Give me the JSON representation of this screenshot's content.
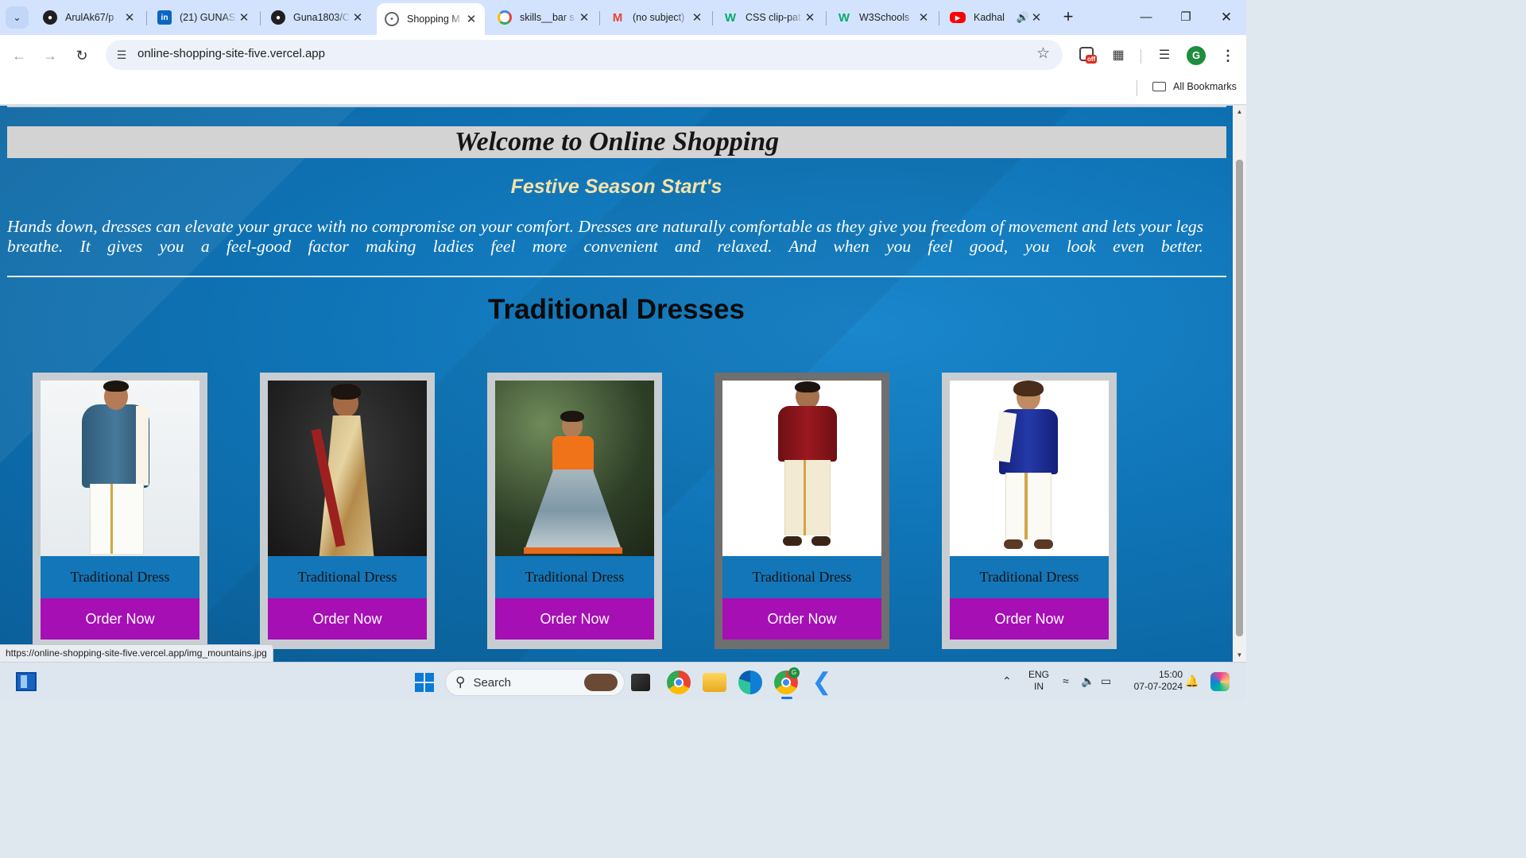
{
  "browser": {
    "tabs": [
      {
        "title": "ArulAk67/p",
        "favicon": "github-icon",
        "color": "#1f1f1f"
      },
      {
        "title": "(21) GUNAS",
        "favicon": "linkedin-icon",
        "color": "#0a66c2"
      },
      {
        "title": "Guna1803/C",
        "favicon": "github-icon",
        "color": "#1f1f1f"
      },
      {
        "title": "Shopping M",
        "favicon": "globe-icon",
        "color": "#5f6368",
        "active": true
      },
      {
        "title": "skills__bar s",
        "favicon": "google-icon",
        "color": "#4285f4"
      },
      {
        "title": "(no subject)",
        "favicon": "gmail-icon",
        "color": "#ea4335"
      },
      {
        "title": "CSS clip-pat",
        "favicon": "w3schools-icon",
        "color": "#04aa6d"
      },
      {
        "title": "W3Schools",
        "favicon": "w3schools-icon",
        "color": "#04aa6d"
      },
      {
        "title": "Kadhal",
        "favicon": "youtube-icon",
        "color": "#ff0000",
        "audio": true
      }
    ],
    "url": "online-shopping-site-five.vercel.app",
    "bookmarks_label": "All Bookmarks",
    "profile_initial": "G",
    "extension_badge": "off",
    "status_url": "https://online-shopping-site-five.vercel.app/img_mountains.jpg"
  },
  "page": {
    "welcome": "Welcome to Online Shopping",
    "festive": "Festive Season Start's",
    "intro": "Hands down, dresses can elevate your grace with no compromise on your comfort. Dresses are naturally comfortable as they give you freedom of movement and lets your legs breathe. It gives you a feel-good factor making ladies feel more convenient and relaxed. And when you feel good, you look even better.",
    "section_title": "Traditional Dresses",
    "products": [
      {
        "caption": "Traditional Dress",
        "button": "Order Now",
        "image": "man-in-silk-shirt-and-dhoti"
      },
      {
        "caption": "Traditional Dress",
        "button": "Order Now",
        "image": "woman-in-silk-saree"
      },
      {
        "caption": "Traditional Dress",
        "button": "Order Now",
        "image": "girl-in-pavadai"
      },
      {
        "caption": "Traditional Dress",
        "button": "Order Now",
        "image": "boy-in-red-shirt-and-dhoti",
        "hovered": true
      },
      {
        "caption": "Traditional Dress",
        "button": "Order Now",
        "image": "boy-in-blue-shirt-and-dhoti"
      }
    ]
  },
  "taskbar": {
    "search_placeholder": "Search",
    "language": "ENG",
    "region": "IN",
    "time": "15:00",
    "date": "07-07-2024"
  }
}
